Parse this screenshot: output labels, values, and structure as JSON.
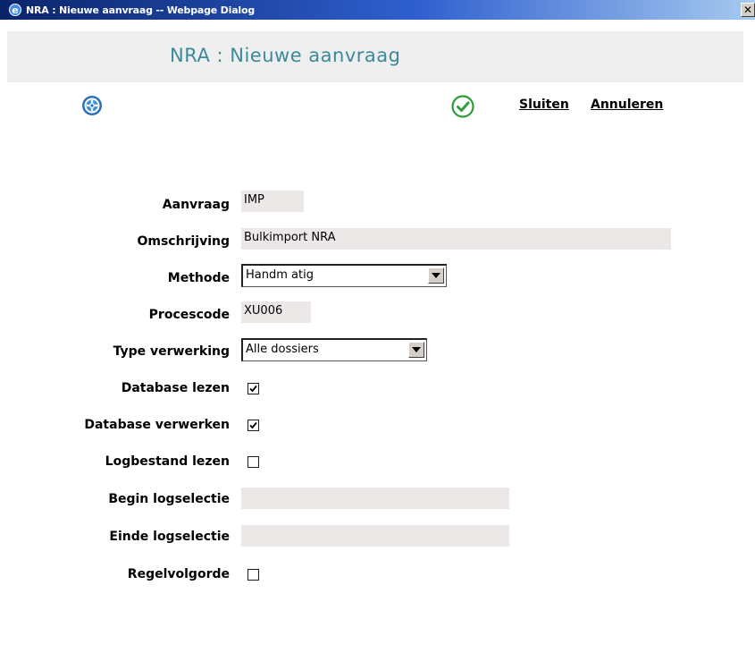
{
  "window": {
    "title": "NRA : Nieuwe aanvraag -- Webpage Dialog",
    "close_glyph": "✕"
  },
  "header": {
    "title": "NRA : Nieuwe aanvraag"
  },
  "toolbar": {
    "settings_icon": "gear-icon",
    "confirm_icon": "check-icon",
    "close_label": "Sluiten",
    "cancel_label": "Annuleren",
    "accent_color": "#3b8a9a",
    "check_color": "#2e9e3a"
  },
  "form": {
    "aanvraag": {
      "label": "Aanvraag",
      "value": "IMP"
    },
    "omschrijving": {
      "label": "Omschrijving",
      "value": "Bulkimport NRA"
    },
    "methode": {
      "label": "Methode",
      "value": "Handm atig"
    },
    "procescode": {
      "label": "Procescode",
      "value": "XU006"
    },
    "type_verwerking": {
      "label": "Type verwerking",
      "value": "Alle dossiers"
    },
    "database_lezen": {
      "label": "Database lezen",
      "checked": true
    },
    "database_verwerken": {
      "label": "Database verwerken",
      "checked": true
    },
    "logbestand_lezen": {
      "label": "Logbestand lezen",
      "checked": false
    },
    "begin_logselectie": {
      "label": "Begin logselectie",
      "value": ""
    },
    "einde_logselectie": {
      "label": "Einde logselectie",
      "value": ""
    },
    "regelvolgorde": {
      "label": "Regelvolgorde",
      "checked": false
    }
  }
}
